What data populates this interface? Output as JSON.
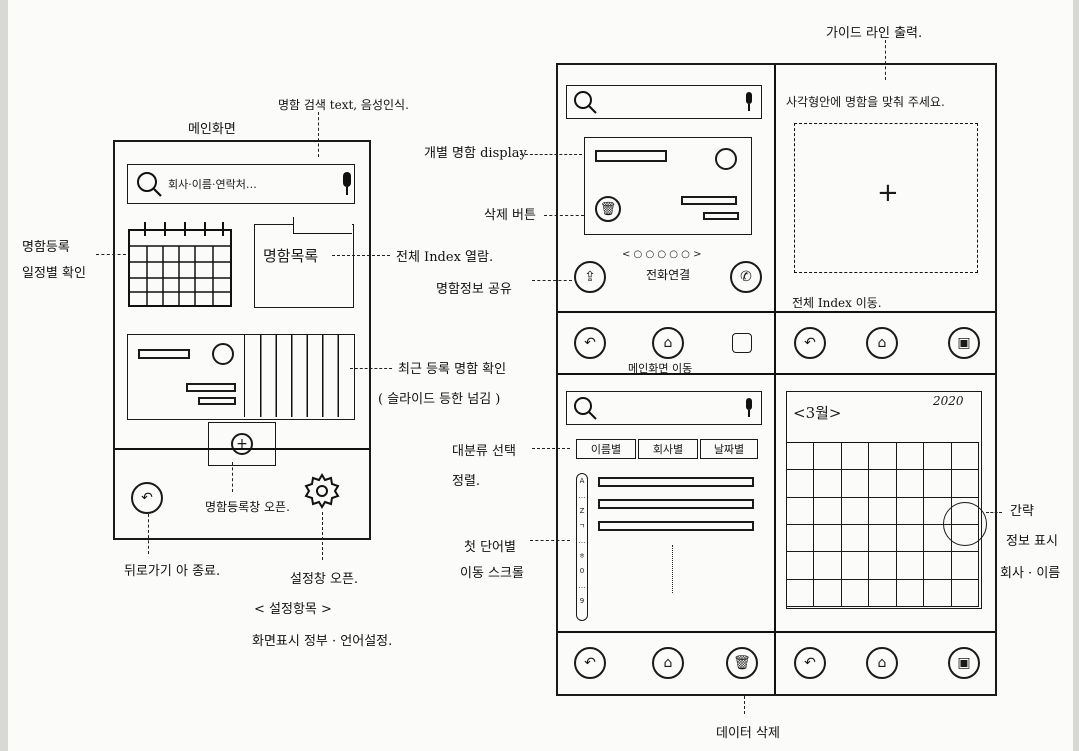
{
  "left_screen": {
    "title": "메인화면",
    "search_placeholder": "회사·이름·연락처…",
    "namecard_list_label": "명함목록"
  },
  "annotations_left": {
    "search_note": "명함 검색 text, 음성인식.",
    "calendar_note_1": "명함등록",
    "calendar_note_2": "일정별 확인",
    "list_note": "전체 Index 열람.",
    "recent_note_1": "최근 등록 명함 확인",
    "recent_note_2": "( 슬라이드 등한 넘김 )",
    "add_note": "명함등록창 오픈.",
    "back_note": "뒤로가기 아 종료.",
    "settings_note_1": "설정창 오픈.",
    "settings_note_2": "< 설정항목 >",
    "settings_note_3": "화면표시 정부 · 언어설정."
  },
  "annotations_right": {
    "guide_note": "가이드 라인 출력.",
    "camera_note": "사각형안에 명함을 맞춰 주세요.",
    "camera_plus": "+",
    "detail_note": "개별 명함 display",
    "delete_note": "삭제 버튼",
    "pager_dots": "< ○ ○ ○ ○ ○ >",
    "share_note": "명함정보 공유",
    "call_note": "전화연결",
    "index_move_note": "전체 Index 이동.",
    "main_move_note": "메인화면 이동",
    "sort_note_1": "대분류 선택",
    "sort_note_2": "정렬.",
    "scroll_note_1": "첫 단어별",
    "scroll_note_2": "이동 스크롤",
    "delete_db_note": "데이터 삭제",
    "cal_detail_1": "간략",
    "cal_detail_2": "정보 표시",
    "cal_detail_3": "회사 · 이름"
  },
  "sort_tabs": [
    "이름별",
    "회사별",
    "날짜별"
  ],
  "index_letters": [
    "A",
    "…",
    "Z",
    "ㄱ",
    "…",
    "ㅎ",
    "0",
    "…",
    "9"
  ],
  "calendar_header": {
    "month": "<3월>",
    "year": "2020"
  }
}
